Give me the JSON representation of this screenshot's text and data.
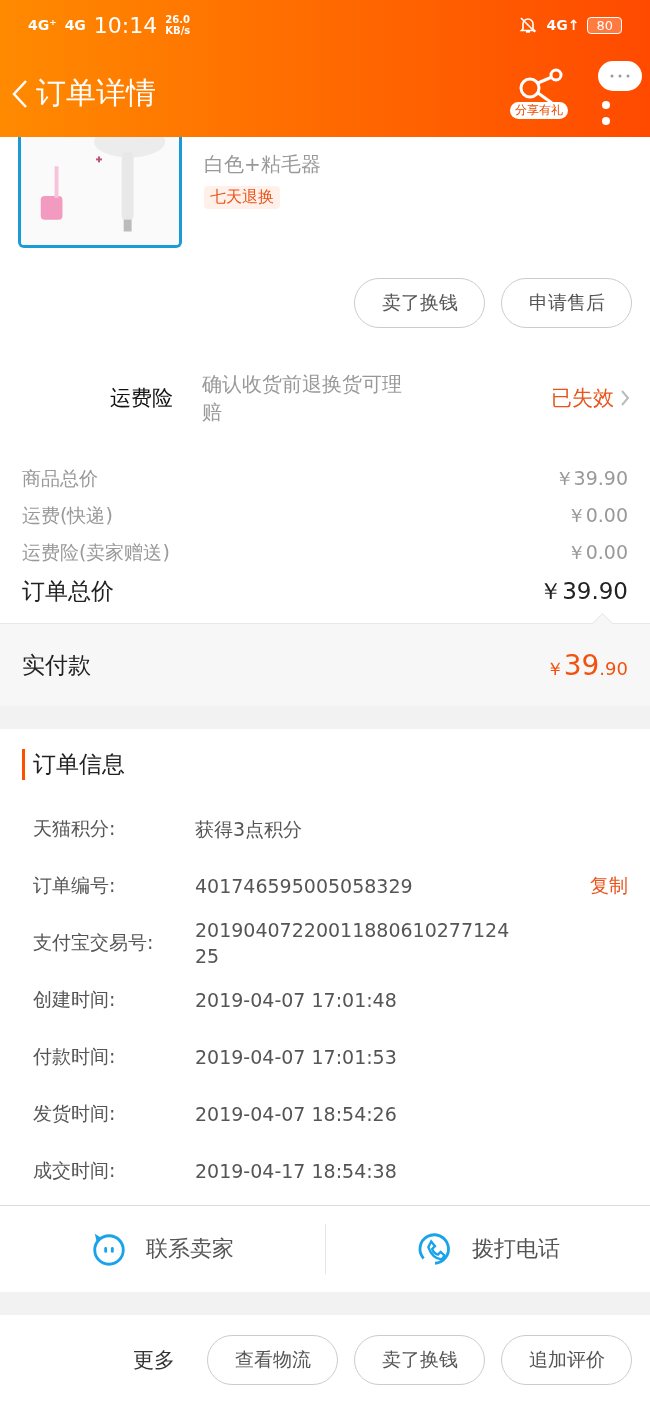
{
  "status_bar": {
    "network_1": "4G⁺",
    "network_2": "4G",
    "time": "10:14",
    "speed_value": "26.0",
    "speed_unit": "KB/s",
    "network_3": "4G↑",
    "battery": "80"
  },
  "header": {
    "title": "订单详情",
    "share_label": "分享有礼"
  },
  "product": {
    "kind": "picture",
    "sku": "白色+粘毛器",
    "tag": "七天退换"
  },
  "product_buttons": [
    "卖了换钱",
    "申请售后"
  ],
  "insurance": {
    "label": "运费险",
    "description": "确认收货前退换货可理赔",
    "status": "已失效"
  },
  "price_rows": [
    {
      "label": "商品总价",
      "value": "￥39.90"
    },
    {
      "label": "运费(快递)",
      "value": "￥0.00"
    },
    {
      "label": "运费险(卖家赠送)",
      "value": "￥0.00"
    }
  ],
  "total": {
    "label": "订单总价",
    "value": "￥39.90"
  },
  "paid": {
    "label": "实付款",
    "currency": "￥",
    "integer": "39",
    "decimal": ".90"
  },
  "order_info": {
    "title": "订单信息",
    "rows": [
      {
        "label": "天猫积分:",
        "value": "获得3点积分"
      },
      {
        "label": "订单编号:",
        "value": "401746595005058329",
        "action": "复制"
      },
      {
        "label": "支付宝交易号:",
        "value": "2019040722001188061027712425"
      },
      {
        "label": "创建时间:",
        "value": "2019-04-07 17:01:48"
      },
      {
        "label": "付款时间:",
        "value": "2019-04-07 17:01:53"
      },
      {
        "label": "发货时间:",
        "value": "2019-04-07 18:54:26"
      },
      {
        "label": "成交时间:",
        "value": "2019-04-17 18:54:38"
      }
    ]
  },
  "contact": [
    {
      "kind": "chat",
      "label": "联系卖家"
    },
    {
      "kind": "phone",
      "label": "拨打电话"
    }
  ],
  "more": {
    "label": "更多",
    "buttons": [
      "查看物流",
      "卖了换钱",
      "追加评价"
    ]
  }
}
